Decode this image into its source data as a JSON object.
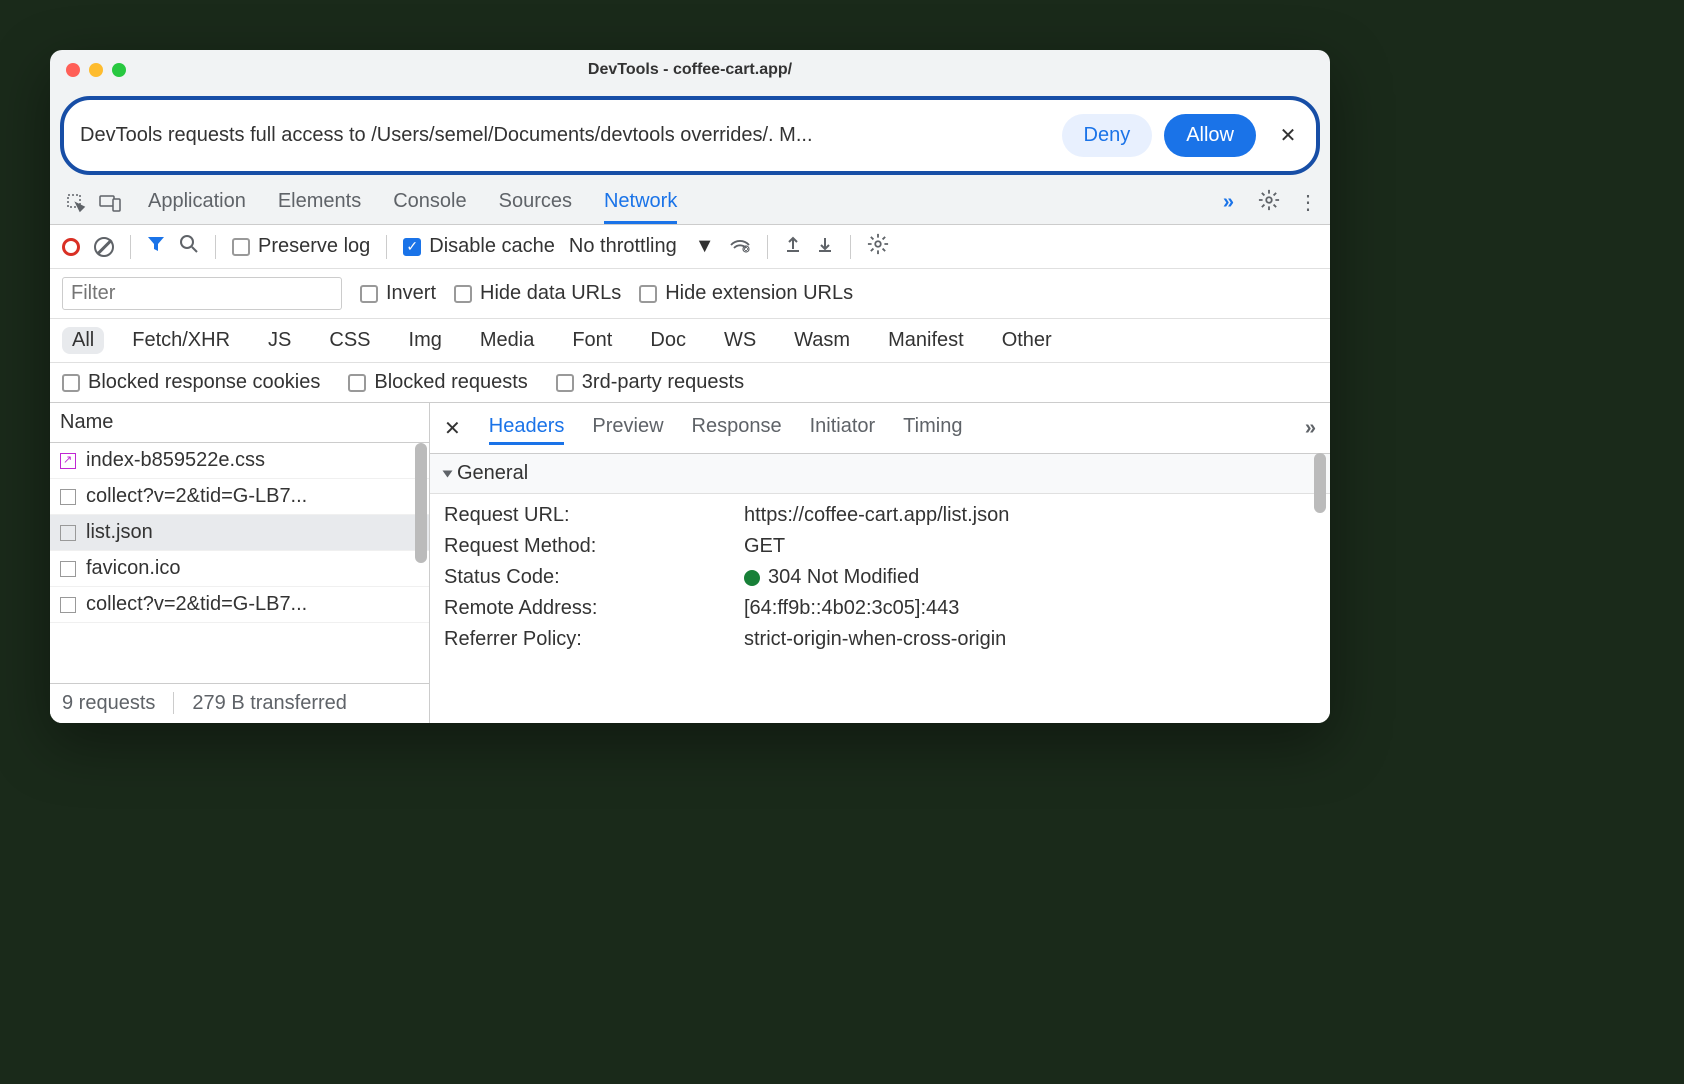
{
  "window": {
    "title": "DevTools - coffee-cart.app/"
  },
  "alert": {
    "message": "DevTools requests full access to /Users/semel/Documents/devtools overrides/. M...",
    "deny_label": "Deny",
    "allow_label": "Allow"
  },
  "tabs": {
    "items": [
      "Application",
      "Elements",
      "Console",
      "Sources",
      "Network"
    ],
    "active": "Network"
  },
  "toolbar": {
    "preserve_log": "Preserve log",
    "disable_cache": "Disable cache",
    "throttling": "No throttling"
  },
  "filter": {
    "placeholder": "Filter",
    "invert": "Invert",
    "hide_data": "Hide data URLs",
    "hide_ext": "Hide extension URLs"
  },
  "types": [
    "All",
    "Fetch/XHR",
    "JS",
    "CSS",
    "Img",
    "Media",
    "Font",
    "Doc",
    "WS",
    "Wasm",
    "Manifest",
    "Other"
  ],
  "block_filters": {
    "cookies": "Blocked response cookies",
    "requests": "Blocked requests",
    "thirdparty": "3rd-party requests"
  },
  "side": {
    "header": "Name",
    "items": [
      {
        "name": "index-b859522e.css",
        "override": true
      },
      {
        "name": "collect?v=2&tid=G-LB7...",
        "override": false
      },
      {
        "name": "list.json",
        "override": false,
        "selected": true
      },
      {
        "name": "favicon.ico",
        "override": false
      },
      {
        "name": "collect?v=2&tid=G-LB7...",
        "override": false
      }
    ]
  },
  "footer": {
    "requests": "9 requests",
    "transferred": "279 B transferred"
  },
  "detail": {
    "tabs": [
      "Headers",
      "Preview",
      "Response",
      "Initiator",
      "Timing"
    ],
    "active_tab": "Headers",
    "section": "General",
    "kv": [
      {
        "k": "Request URL:",
        "v": "https://coffee-cart.app/list.json"
      },
      {
        "k": "Request Method:",
        "v": "GET"
      },
      {
        "k": "Status Code:",
        "v": "304 Not Modified",
        "status": true
      },
      {
        "k": "Remote Address:",
        "v": "[64:ff9b::4b02:3c05]:443"
      },
      {
        "k": "Referrer Policy:",
        "v": "strict-origin-when-cross-origin"
      }
    ]
  }
}
